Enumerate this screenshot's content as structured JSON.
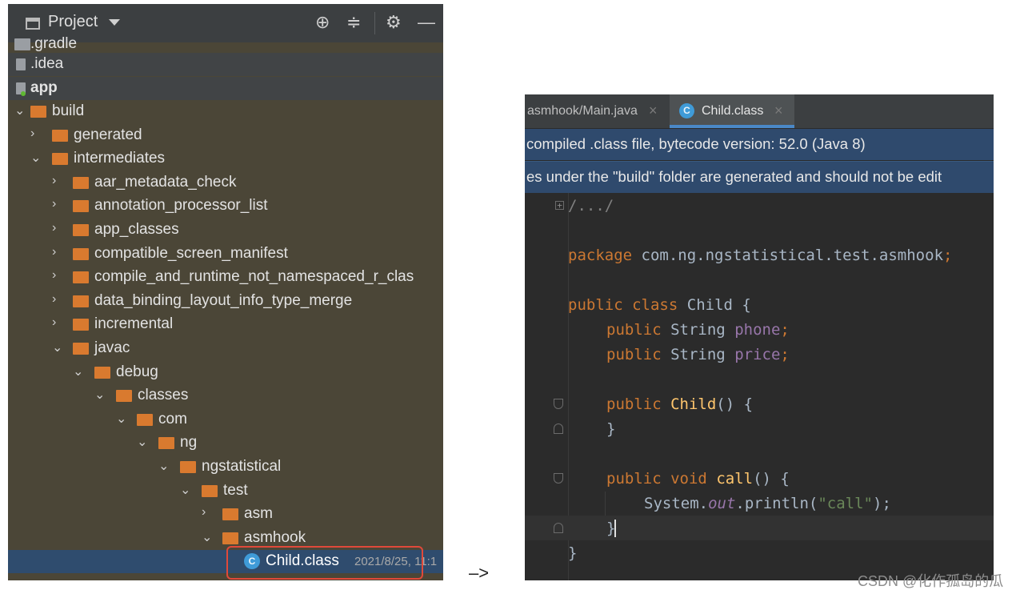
{
  "project_panel": {
    "title": "Project",
    "items": [
      {
        "label": ".gradle"
      },
      {
        "label": ".idea"
      },
      {
        "label": "app"
      },
      {
        "label": "build"
      },
      {
        "label": "generated"
      },
      {
        "label": "intermediates"
      },
      {
        "label": "aar_metadata_check"
      },
      {
        "label": "annotation_processor_list"
      },
      {
        "label": "app_classes"
      },
      {
        "label": "compatible_screen_manifest"
      },
      {
        "label": "compile_and_runtime_not_namespaced_r_clas"
      },
      {
        "label": "data_binding_layout_info_type_merge"
      },
      {
        "label": "incremental"
      },
      {
        "label": "javac"
      },
      {
        "label": "debug"
      },
      {
        "label": "classes"
      },
      {
        "label": "com"
      },
      {
        "label": "ng"
      },
      {
        "label": "ngstatistical"
      },
      {
        "label": "test"
      },
      {
        "label": "asm"
      },
      {
        "label": "asmhook"
      },
      {
        "label": "Child.class",
        "date": "2021/8/25, 11:1"
      }
    ],
    "colors": {
      "folder": "#d97a2f",
      "selection": "#2f4c6e",
      "highlight_box": "#e0493a"
    }
  },
  "flow_arrow": "–>",
  "editor": {
    "tabs": [
      {
        "label": "asmhook/Main.java",
        "active": false
      },
      {
        "label": "Child.class",
        "active": true,
        "icon_letter": "C"
      }
    ],
    "banners": [
      "compiled .class file, bytecode version: 52.0 (Java 8)",
      "es under the \"build\" folder are generated and should not be edit"
    ],
    "code": {
      "header": "/.../",
      "package_kw": "package",
      "package_name": " com.ng.ngstatistical.test.asmhook",
      "semi": ";",
      "public": "public",
      "class": "class",
      "void": "void",
      "class_name": "Child",
      "open_brace": " {",
      "close_brace": "}",
      "string_type": "String",
      "field1": "phone",
      "field2": "price",
      "constructor_name": "Child",
      "parens": "()",
      "method_name": "call",
      "system": "System.",
      "out": "out",
      "println": ".println(",
      "call_string": "\"call\"",
      "close_call": ");"
    }
  },
  "watermark": "CSDN @化作孤岛的瓜"
}
